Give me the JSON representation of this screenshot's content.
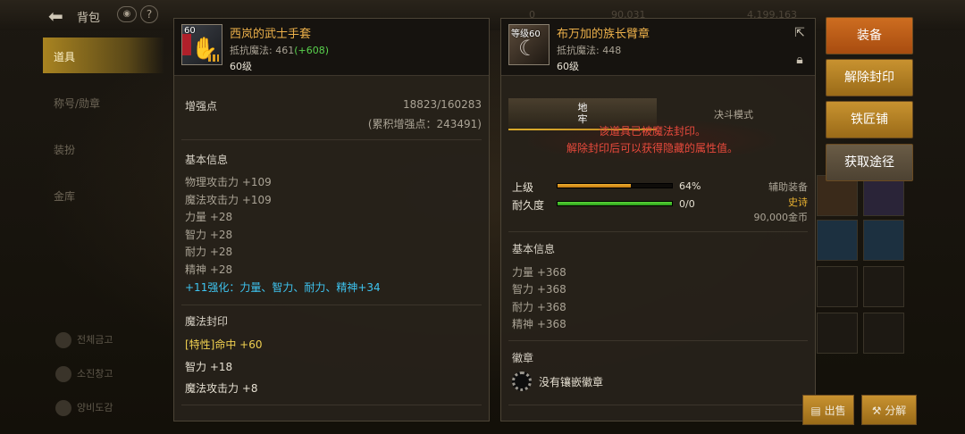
{
  "top_bar": {
    "back_icon": "back-arrow-icon",
    "title": "背包",
    "currency": [
      "0 ",
      "90,031 ",
      "4,199,163 "
    ]
  },
  "left_nav": {
    "tabs": [
      "道具",
      "称号/勋章",
      "装扮",
      "金库"
    ],
    "links": [
      "전체금고",
      "소진창고",
      "양비도감"
    ]
  },
  "left_item": {
    "name": "西岚的武士手套",
    "level_badge": "60",
    "resist_label": "抵抗魔法: 461",
    "resist_bonus": "(+608)",
    "level": "60级",
    "enhance": {
      "label": "增强点",
      "value": "18823/160283",
      "total": "(累积增强点：243491)"
    },
    "basic_info": {
      "title": "基本信息",
      "stats": [
        "物理攻击力 +109",
        "魔法攻击力 +109",
        "力量 +28",
        "智力 +28",
        "耐力 +28",
        "精神 +28"
      ],
      "enhance_line": "+11强化：力量、智力、耐力、精神+34"
    },
    "seal": {
      "title": "魔法封印",
      "lines": [
        "[特性]命中 +60",
        "智力 +18",
        "魔法攻击力 +8"
      ]
    }
  },
  "right_item": {
    "name": "布万加的族长臂章",
    "level_badge": "等级60",
    "resist_label": "抵抗魔法: 448",
    "level": "60级",
    "tabs": [
      "地\n牢",
      "决斗模式"
    ],
    "seal_msg": [
      "该道具已被魔法封印。",
      "解除封印后可以获得隐藏的属性值。"
    ],
    "grade": {
      "label": "上级",
      "value": "64%",
      "percent": 64
    },
    "durability": {
      "label": "耐久度",
      "value": "0/0",
      "percent": 100
    },
    "type": "辅助装备",
    "rarity": "史诗",
    "price": "90,000金币",
    "basic_info": {
      "title": "基本信息",
      "stats": [
        "力量 +368",
        "智力 +368",
        "耐力 +368",
        "精神 +368"
      ]
    },
    "emblem": {
      "title": "徽章",
      "empty": "没有镶嵌徽章"
    }
  },
  "actions": {
    "equip": "装备",
    "unseal": "解除封印",
    "smith": "铁匠铺",
    "source": "获取途径",
    "sell": "出售",
    "disassemble": "分解"
  },
  "colors": {
    "item_name": "#ecb04a",
    "bonus_green": "#59d24d",
    "enhance_cyan": "#3ec4f0",
    "seal_yellow": "#f0d050",
    "seal_warning": "#e84a3c",
    "grade_bar": "#e0a020",
    "durability_bar": "#3ec020",
    "epic": "#e0a020"
  }
}
